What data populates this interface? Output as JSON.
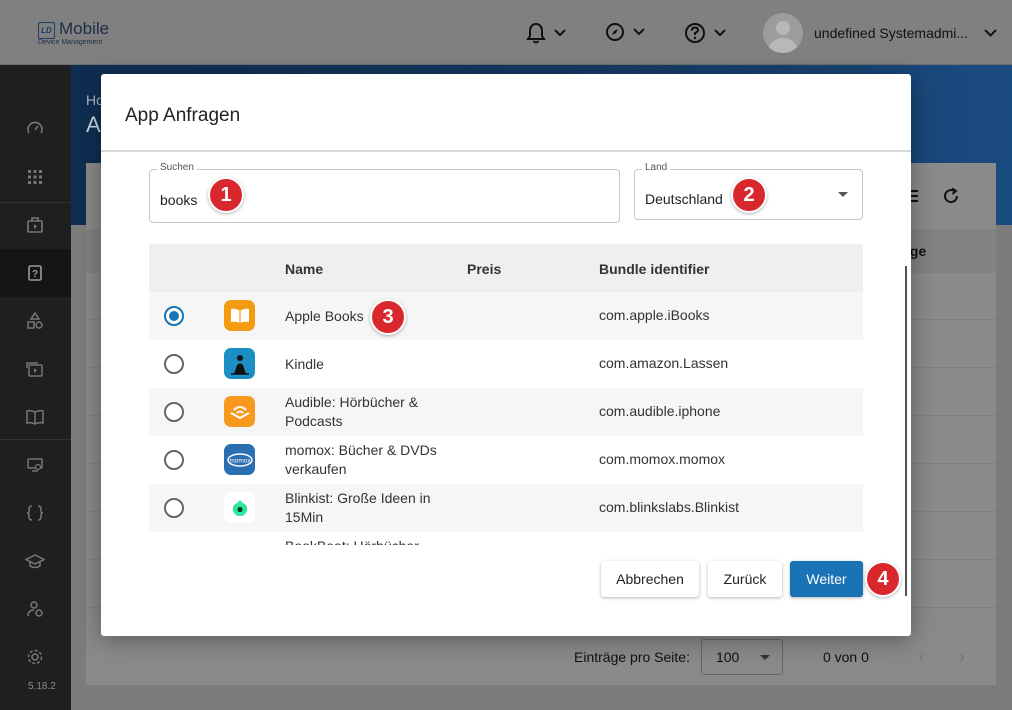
{
  "app": {
    "logo_box": "LD",
    "logo_title": "Mobile",
    "logo_subtitle": "Device Management",
    "user_name": "undefined Systemadmi...",
    "version": "5.18.2"
  },
  "background": {
    "breadcrumb": "Ho",
    "page_title": "A",
    "column_header": "ige",
    "entries_per_page_label": "Einträge pro Seite:",
    "entries_per_page_value": "100",
    "count_text": "0 von 0"
  },
  "modal": {
    "title": "App Anfragen",
    "search": {
      "label": "Suchen",
      "value": "books"
    },
    "country": {
      "label": "Land",
      "value": "Deutschland"
    },
    "table": {
      "headers": {
        "name": "Name",
        "price": "Preis",
        "bundle": "Bundle identifier"
      },
      "rows": [
        {
          "name": "Apple Books",
          "price": "",
          "bundle": "com.apple.iBooks",
          "selected": true,
          "icon": "apple-books-icon"
        },
        {
          "name": "Kindle",
          "price": "",
          "bundle": "com.amazon.Lassen",
          "selected": false,
          "icon": "kindle-icon"
        },
        {
          "name": "Audible: Hörbücher & Podcasts",
          "price": "",
          "bundle": "com.audible.iphone",
          "selected": false,
          "icon": "audible-icon"
        },
        {
          "name": "momox: Bücher & DVDs verkaufen",
          "price": "",
          "bundle": "com.momox.momox",
          "selected": false,
          "icon": "momox-icon"
        },
        {
          "name": "Blinkist: Große Ideen in 15Min",
          "price": "",
          "bundle": "com.blinkslabs.Blinkist",
          "selected": false,
          "icon": "blinkist-icon"
        },
        {
          "name": "BookBeat: Hörbücher",
          "price": "",
          "bundle": "",
          "selected": false,
          "icon": ""
        }
      ]
    },
    "buttons": {
      "cancel": "Abbrechen",
      "back": "Zurück",
      "next": "Weiter"
    }
  },
  "annotations": [
    "1",
    "2",
    "3",
    "4"
  ],
  "colors": {
    "primary": "#1a73b5",
    "badge": "#d9272e"
  }
}
